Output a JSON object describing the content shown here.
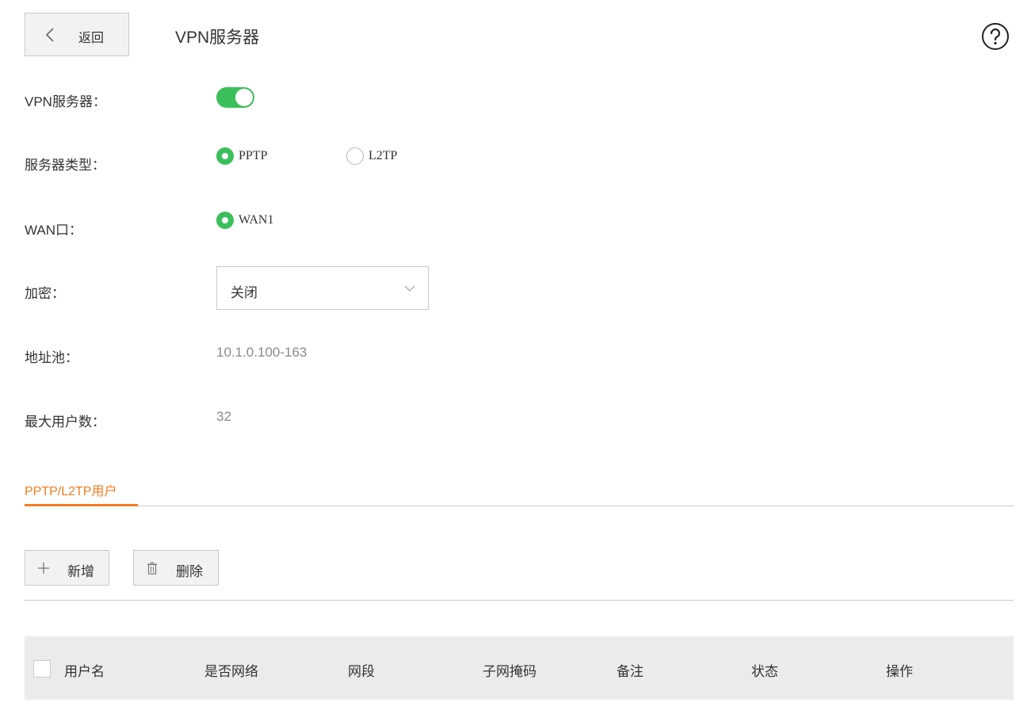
{
  "header": {
    "back_label": "返回",
    "title": "VPN服务器",
    "back_icon": "chevron-left-icon",
    "help_icon": "question-circle-icon"
  },
  "form": {
    "vpn_server": {
      "label": "VPN服务器：",
      "enabled": true
    },
    "server_type": {
      "label": "服务器类型：",
      "options": [
        "PPTP",
        "L2TP"
      ],
      "selected": "PPTP"
    },
    "wan": {
      "label": "WAN口：",
      "options": [
        "WAN1"
      ],
      "selected": "WAN1"
    },
    "encryption": {
      "label": "加密：",
      "value": "关闭"
    },
    "address_pool": {
      "label": "地址池：",
      "value": "10.1.0.100-163"
    },
    "max_users": {
      "label": "最大用户数：",
      "value": "32"
    }
  },
  "tabs": [
    {
      "label": "PPTP/L2TP用户",
      "active": true
    }
  ],
  "toolbar": {
    "add_label": "新增",
    "delete_label": "删除",
    "add_icon": "plus-icon",
    "delete_icon": "trash-icon"
  },
  "table": {
    "columns": [
      "用户名",
      "是否网络",
      "网段",
      "子网掩码",
      "备注",
      "状态",
      "操作"
    ],
    "rows": []
  },
  "colors": {
    "accent": "#3bbf5a",
    "tab_accent": "#f47c22",
    "header_bg": "#ebebeb"
  }
}
